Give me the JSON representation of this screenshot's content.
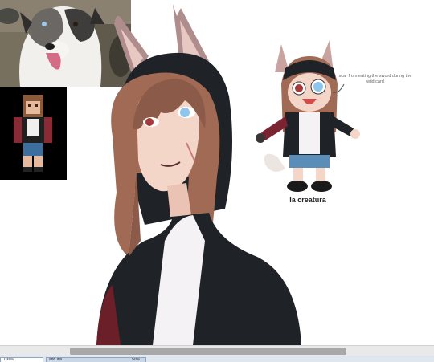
{
  "canvas": {
    "annotation": "scar from eating the sword during the wild card",
    "caption": "la creatura"
  },
  "taskbar": {
    "items": [
      {
        "label": "100%",
        "active": true
      },
      {
        "label": "add ins",
        "active": false
      },
      {
        "label": "50%",
        "active": false
      }
    ]
  },
  "colors": {
    "hoodie": "#1f2227",
    "hair": "#a06a55",
    "skin": "#f4d6c9",
    "ear": "#c9a3a0",
    "eye_blue": "#8ec5ef",
    "eye_red": "#a63a3a",
    "shirt": "#f4f2f4",
    "sleeve_red": "#7b2330"
  }
}
